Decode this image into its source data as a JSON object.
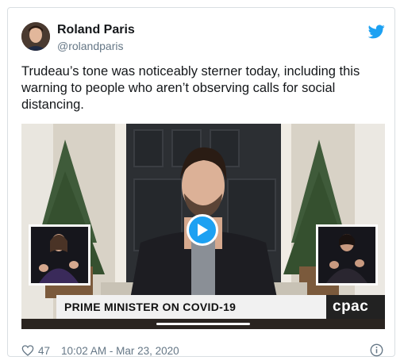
{
  "author": {
    "name": "Roland Paris",
    "handle": "@rolandparis"
  },
  "tweet": {
    "text": "Trudeau’s tone was noticeably sterner today, including this warning to people who aren’t observing calls for social distancing."
  },
  "video": {
    "banner_text": "PRIME MINISTER ON COVID-19",
    "channel_logo": "cpac",
    "play_icon": "play-icon"
  },
  "footer": {
    "likes": "47",
    "timestamp": "10:02 AM - Mar 23, 2020",
    "heart_icon": "heart-icon",
    "info_icon": "info-icon"
  },
  "colors": {
    "accent": "#1da1f2",
    "secondary_text": "#657786"
  }
}
